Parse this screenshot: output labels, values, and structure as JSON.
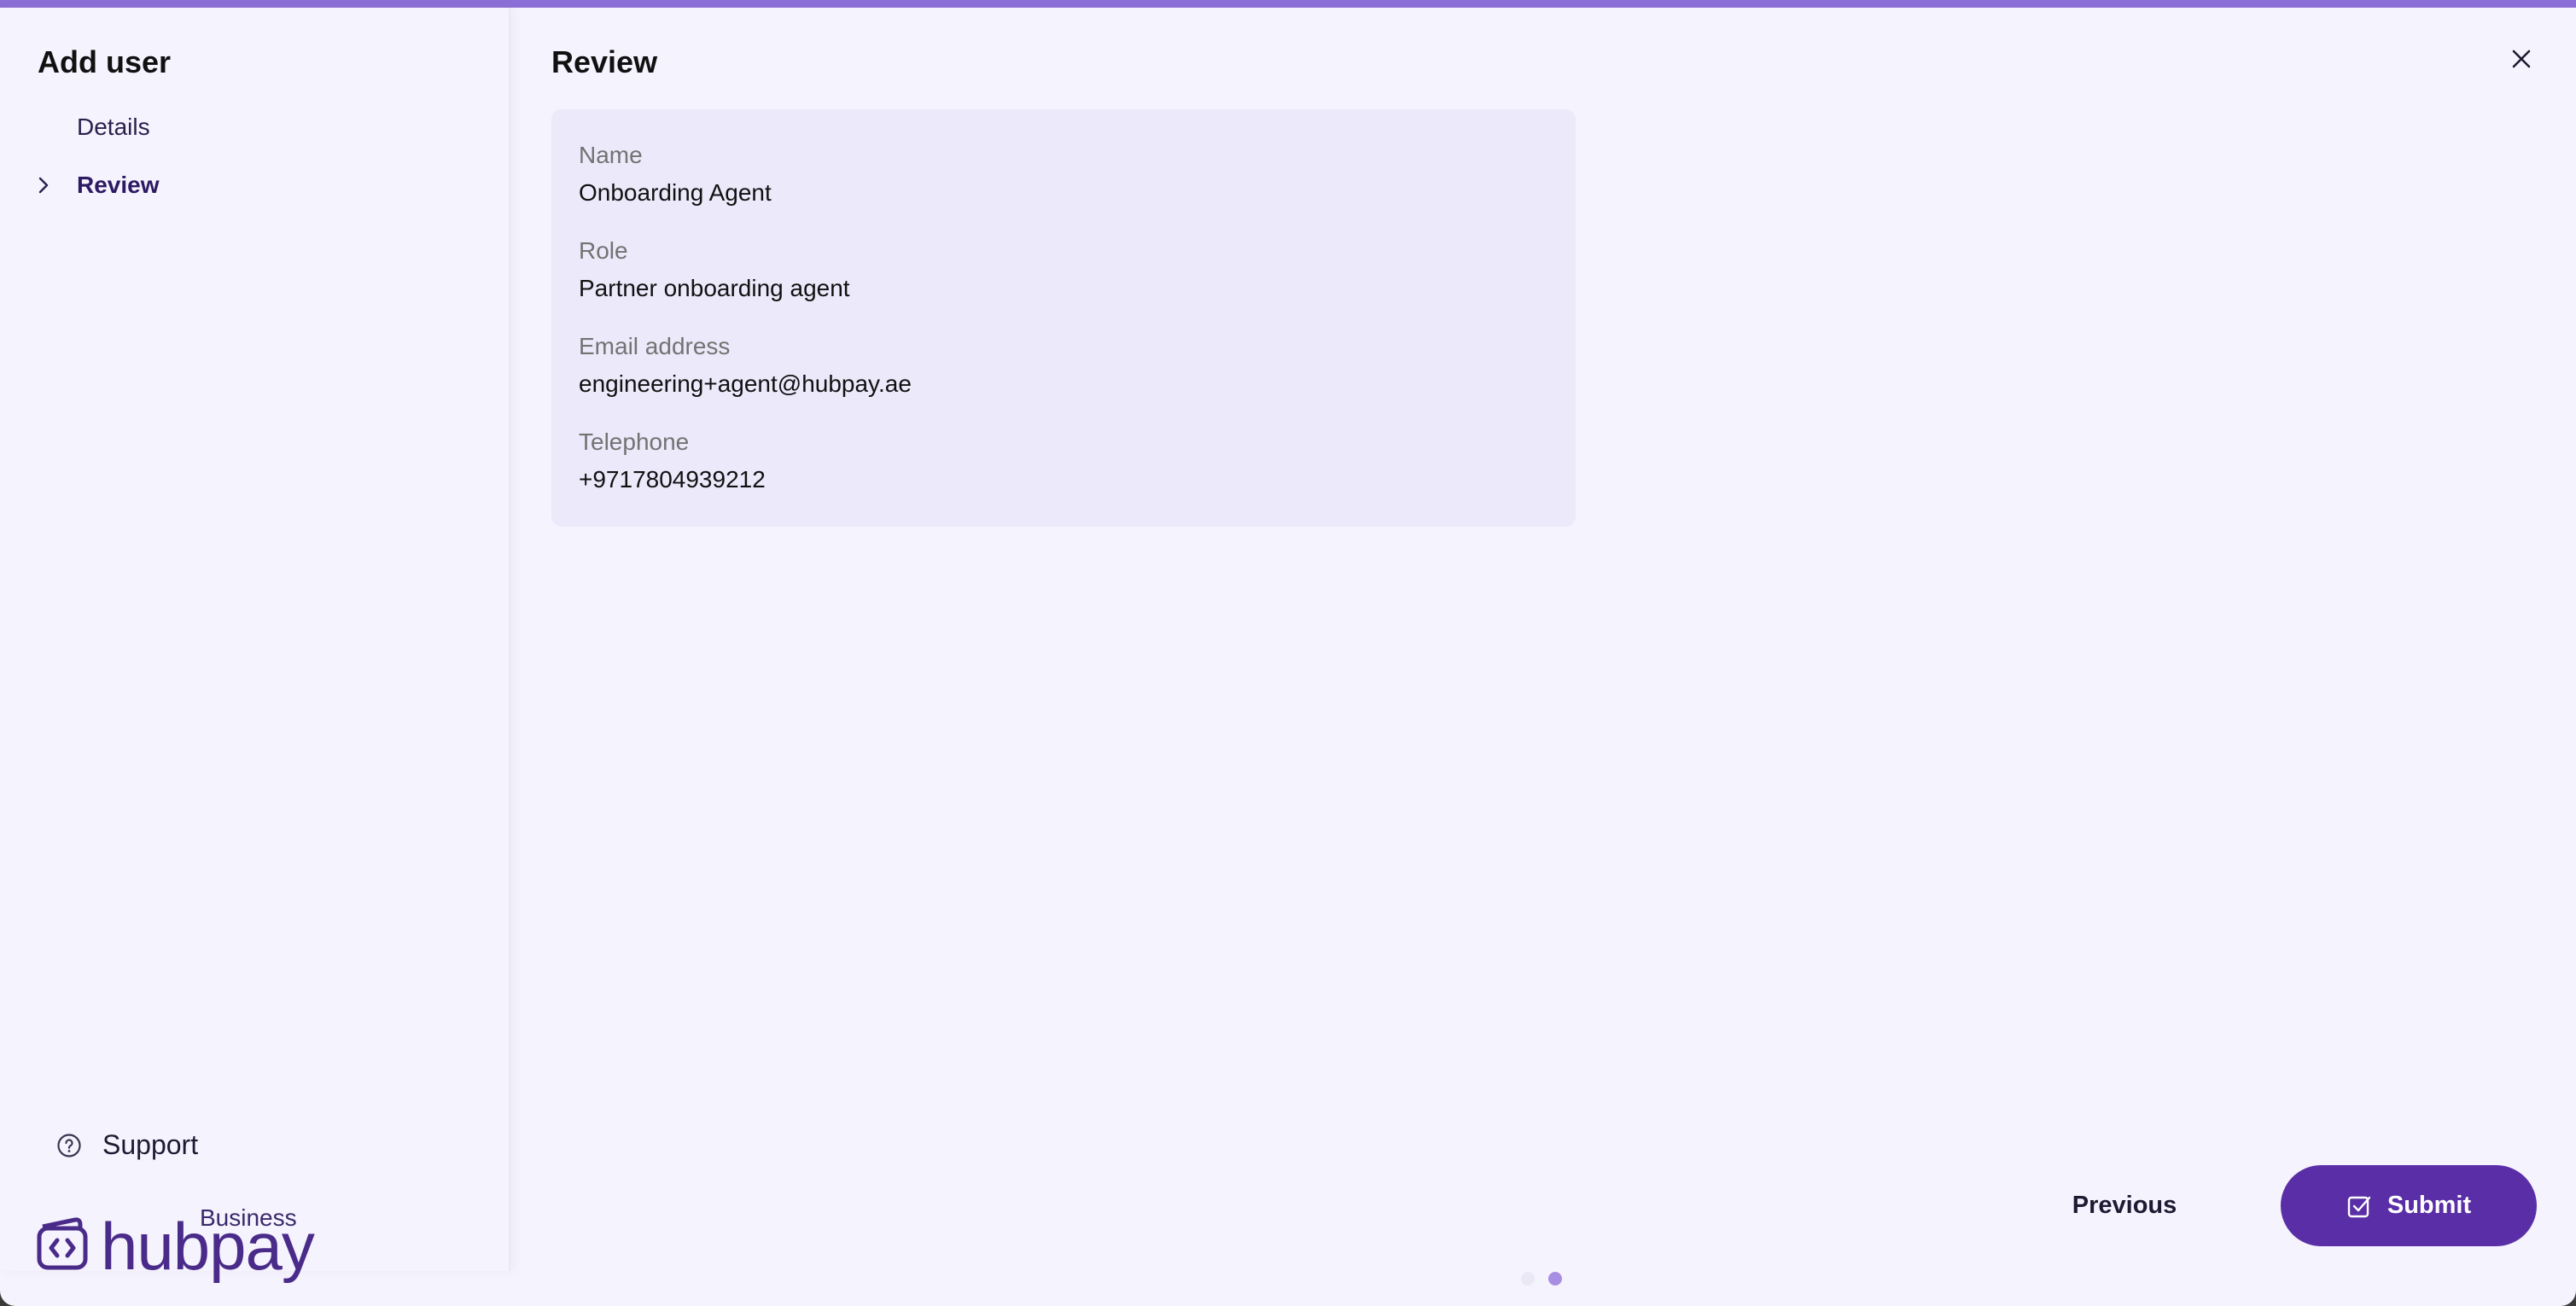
{
  "sidebar": {
    "title": "Add user",
    "items": [
      {
        "label": "Details",
        "active": false
      },
      {
        "label": "Review",
        "active": true
      }
    ],
    "support_label": "Support",
    "logo": {
      "brand": "hubpay",
      "tagline": "Business"
    }
  },
  "main": {
    "title": "Review",
    "fields": [
      {
        "label": "Name",
        "value": "Onboarding Agent"
      },
      {
        "label": "Role",
        "value": "Partner onboarding agent"
      },
      {
        "label": "Email address",
        "value": "engineering+agent@hubpay.ae"
      },
      {
        "label": "Telephone",
        "value": "+9717804939212"
      }
    ]
  },
  "footer": {
    "previous_label": "Previous",
    "submit_label": "Submit",
    "steps_total": 2,
    "current_step": 2
  },
  "colors": {
    "accent": "#5a2ea6",
    "top_bar": "#8b6fd6",
    "background": "#f5f3fd",
    "card": "#ece9fa"
  },
  "icons": {
    "close": "close-icon",
    "chevron": "chevron-right-icon",
    "support": "help-circle-icon",
    "submit": "checkbox-icon"
  }
}
